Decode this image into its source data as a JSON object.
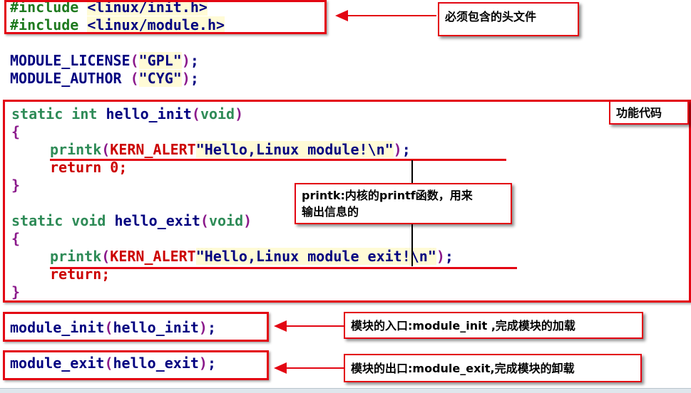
{
  "code": {
    "inc1_kw": "#include",
    "inc1_path": "<linux/init.h>",
    "inc2_kw": "#include",
    "inc2_path": "<linux/module.h>",
    "lic_fn": "MODULE_LICENSE",
    "lic_str": "\"GPL\"",
    "auth_fn": "MODULE_AUTHOR",
    "auth_str": "\"CYG\"",
    "init_kw": "static int",
    "init_name": "hello_init",
    "void1": "void",
    "printk1": "printk",
    "kern1": "KERN_ALERT",
    "str1": "\"Hello,Linux module!\\n\"",
    "return_kw": "return",
    "return_val": "0",
    "exit_kw": "static void",
    "exit_name": "hello_exit",
    "void2": "void",
    "printk2": "printk",
    "kern2": "KERN_ALERT",
    "str2": "\"Hello,Linux module exit!\\n\"",
    "return2": "return",
    "modinit_fn": "module_init",
    "modinit_arg": "hello_init",
    "modexit_fn": "module_exit",
    "modexit_arg": "hello_exit"
  },
  "annotations": {
    "headers_note": "必须包含的头文件",
    "function_note": "功能代码",
    "printk_note_line1": "printk:内核的printf函数，用来",
    "printk_note_line2": "输出信息的",
    "init_note": "模块的入口:module_init ,完成模块的加载",
    "exit_note": "模块的出口:module_exit,完成模块的卸载"
  },
  "colors": {
    "annotation_red": "#e30613",
    "keyword_green": "#2e8b57",
    "identifier_navy": "#000080",
    "paren_purple": "#8b1a8b"
  }
}
